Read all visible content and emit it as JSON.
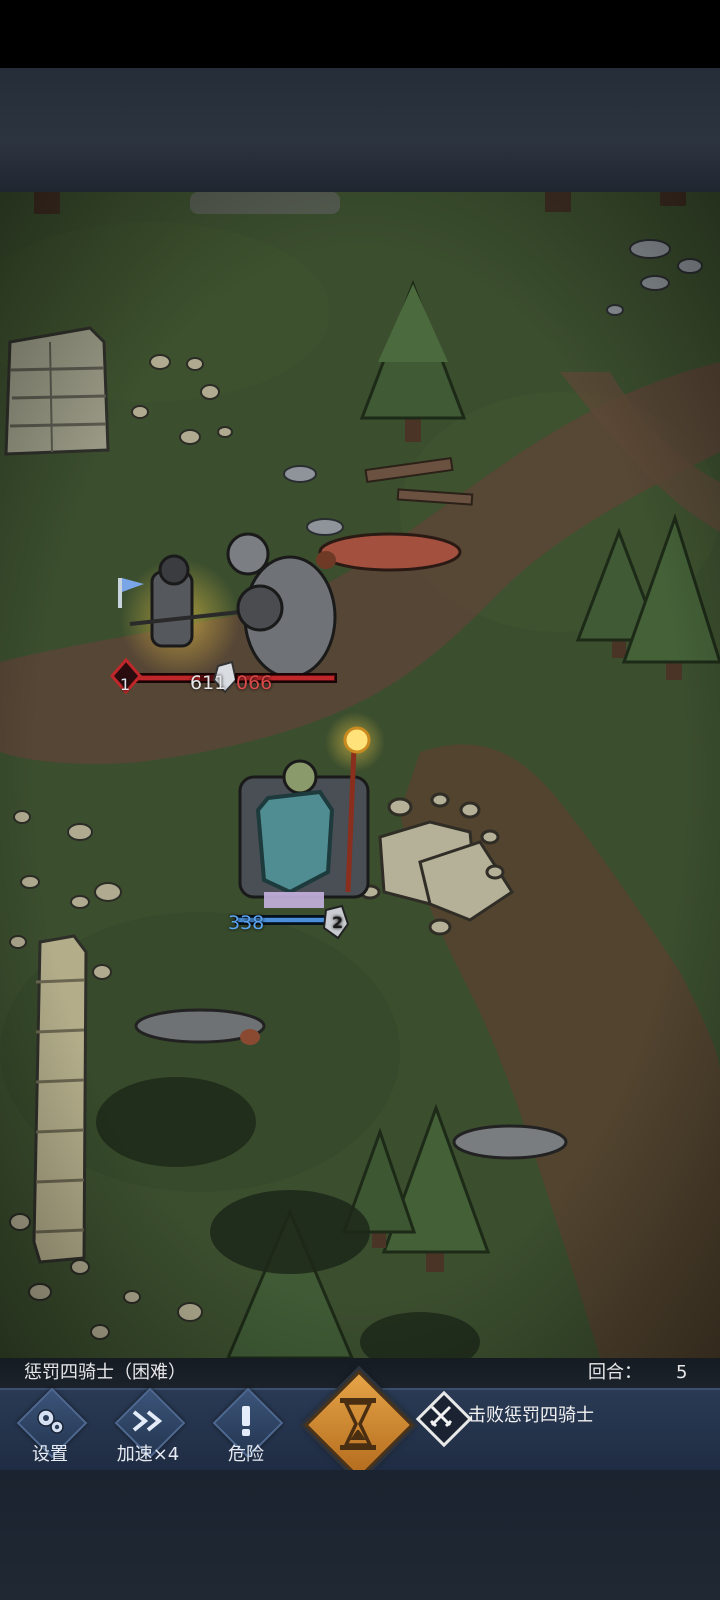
{
  "status": {
    "level_name": "惩罚四骑士（困难）",
    "round_label": "回合：",
    "round_value": "5"
  },
  "actions": [
    {
      "id": "settings",
      "label": "设置",
      "icon": "gear-icon"
    },
    {
      "id": "speed",
      "label": "加速×4",
      "icon": "fast-forward-icon"
    },
    {
      "id": "danger",
      "label": "危险",
      "icon": "exclamation-icon"
    }
  ],
  "end_turn": {
    "icon": "hourglass-icon"
  },
  "objective": {
    "text": "击败惩罚四骑士",
    "icon": "crossed-swords-icon"
  },
  "units": {
    "enemy_knight": {
      "level": "1",
      "hp": "611"
    },
    "enemy_shield": {
      "hp": "066"
    },
    "player_unit": {
      "hp": "338",
      "level": "2"
    }
  },
  "colors": {
    "grass": "#3b4e2e",
    "dirt": "#5a4636",
    "action_bar": "#253650",
    "hourglass_gold": "#d88f35",
    "enemy_hp": "#c0272a",
    "player_hp": "#4a8fd8"
  }
}
